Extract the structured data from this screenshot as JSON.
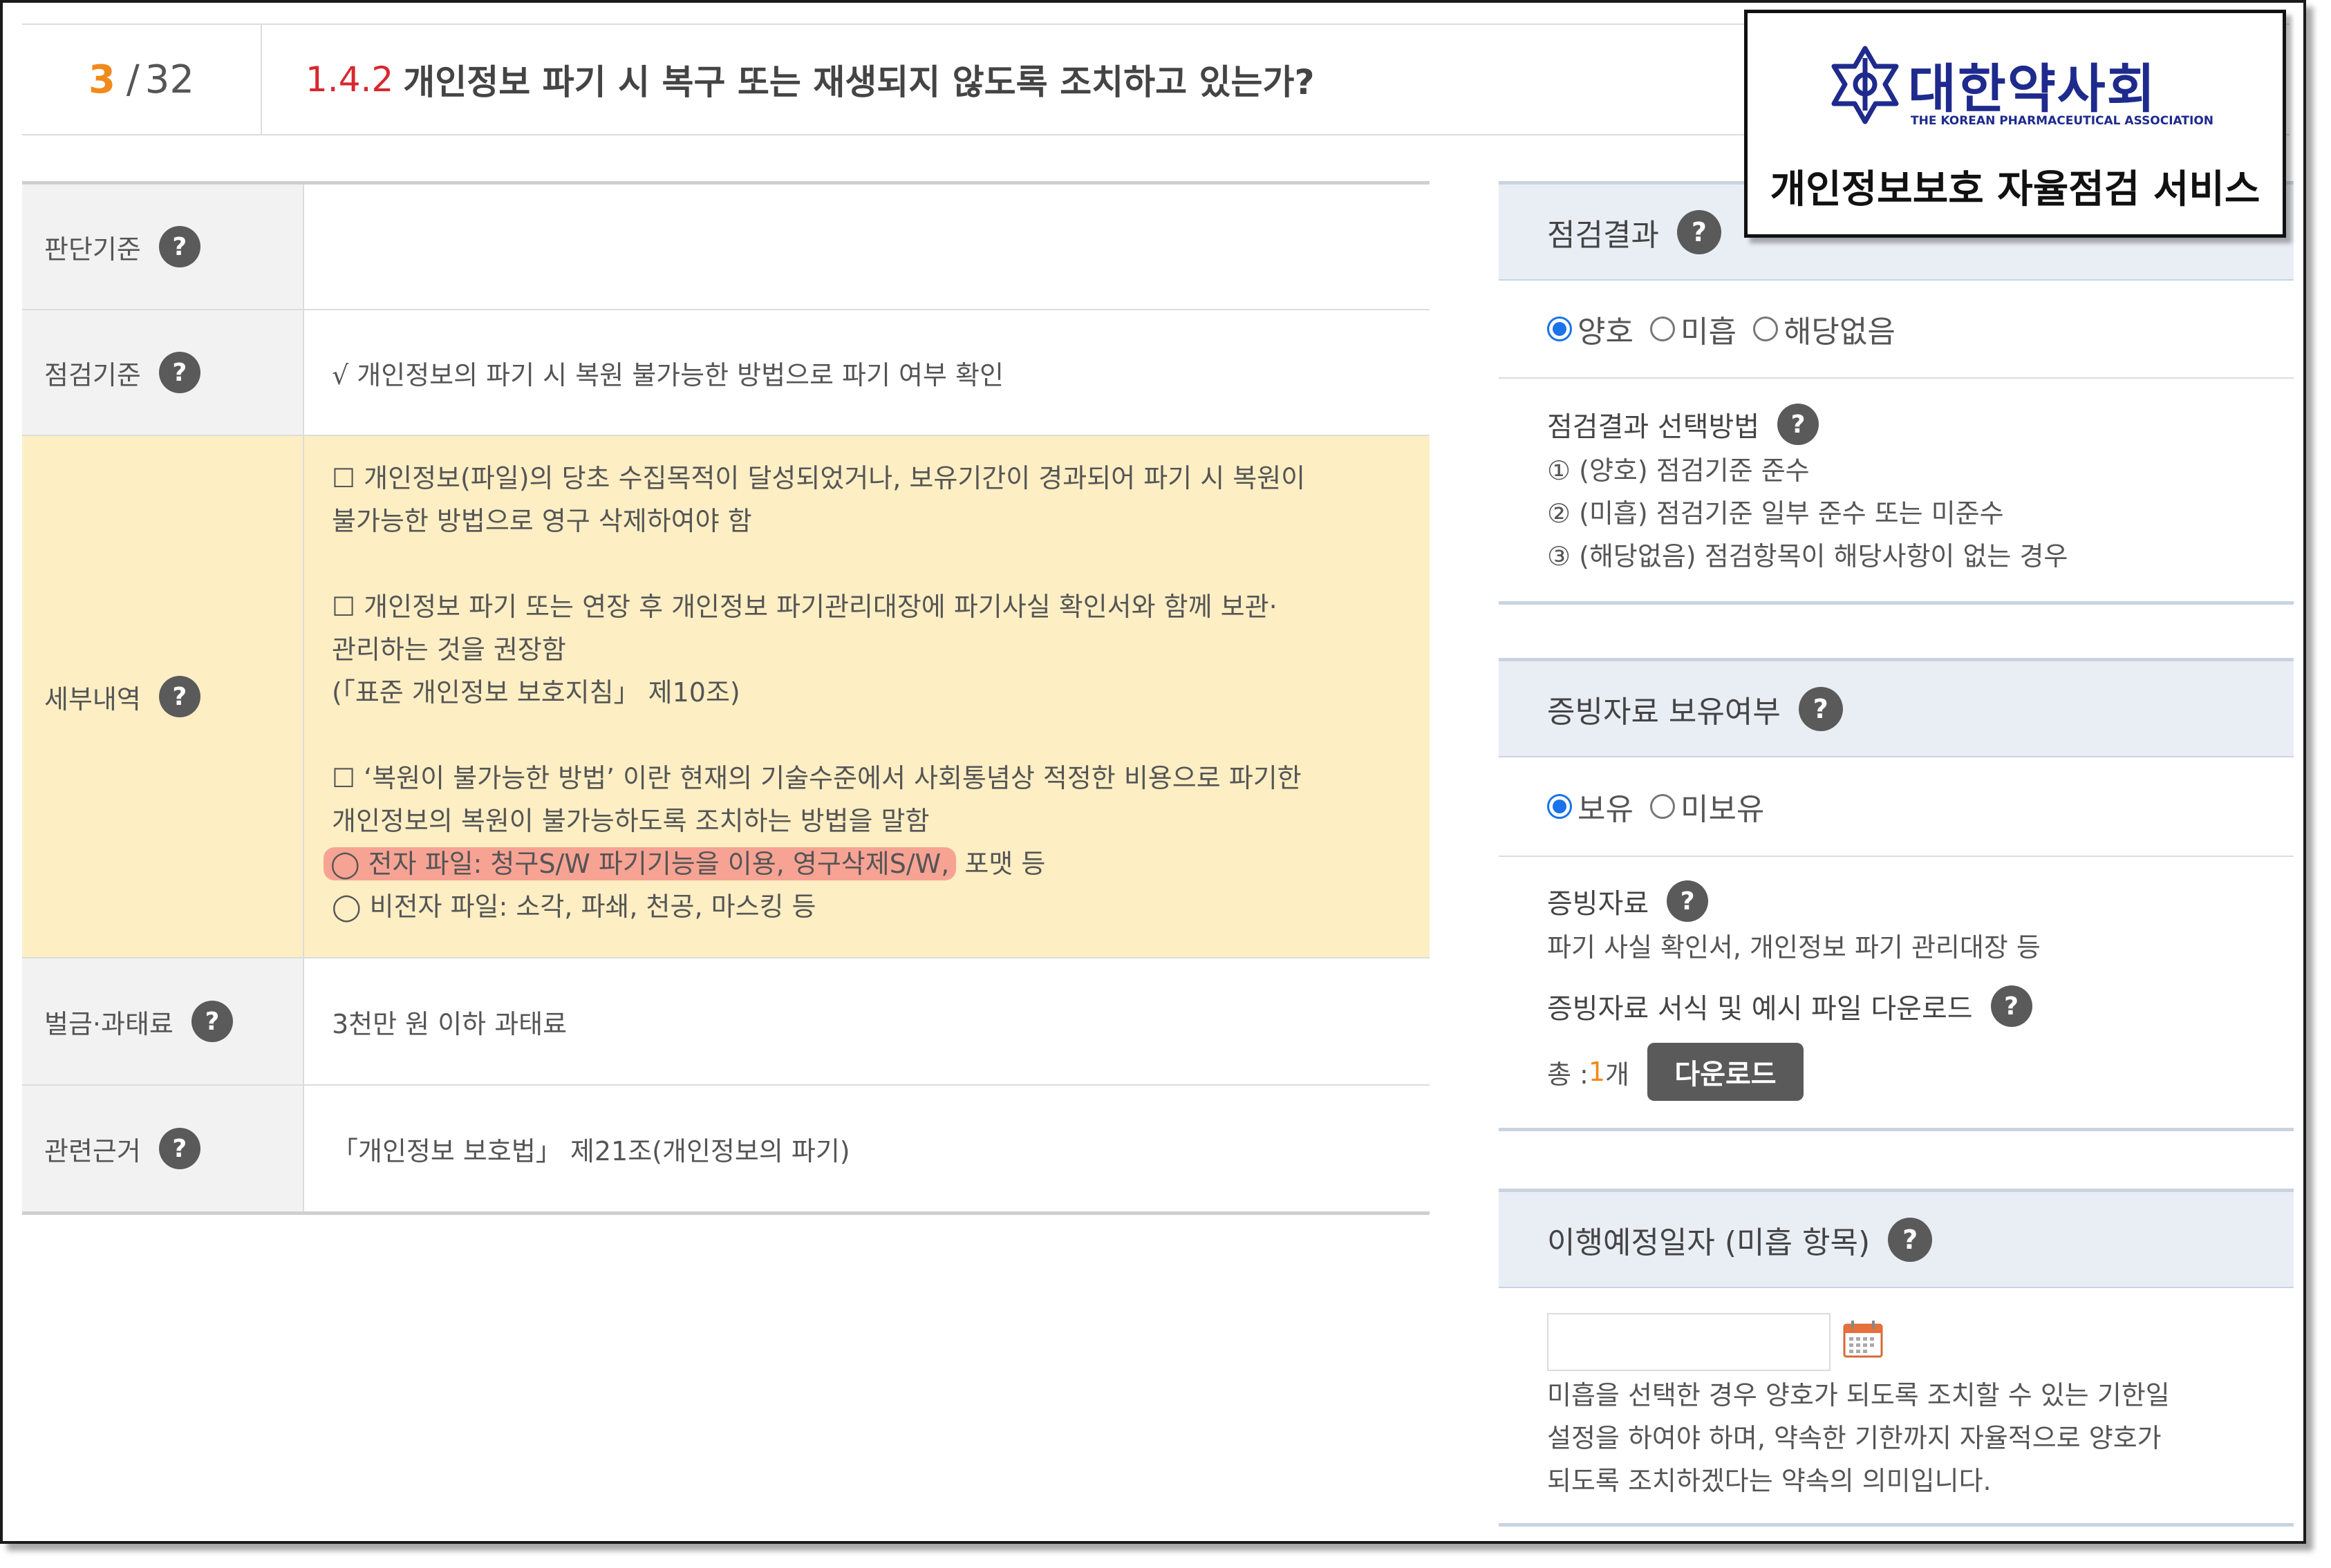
{
  "header": {
    "current": "3",
    "separator": "/",
    "total": "32",
    "item_number": "1.4.2",
    "item_title": "개인정보 파기 시 복구 또는 재생되지 않도록 조치하고 있는가?"
  },
  "table": {
    "judgement_label": "판단기준",
    "check_label": "점검기준",
    "check_value": "√ 개인정보의 파기 시 복원 불가능한 방법으로 파기 여부 확인",
    "detail_label": "세부내역",
    "detail": {
      "p1_line1": "☐ 개인정보(파일)의 당초 수집목적이 달성되었거나, 보유기간이 경과되어 파기 시 복원이",
      "p1_line2": "불가능한 방법으로 영구 삭제하여야 함",
      "p2_line1": "☐ 개인정보 파기 또는 연장 후 개인정보 파기관리대장에 파기사실 확인서와 함께 보관·",
      "p2_line2": "관리하는 것을 권장함",
      "p2_line3": "(「표준 개인정보 보호지침」 제10조)",
      "p3_line1": "☐ ‘복원이 불가능한 방법’ 이란 현재의 기술수준에서 사회통념상 적정한 비용으로 파기한",
      "p3_line2": "개인정보의 복원이 불가능하도록 조치하는 방법을 말함",
      "p3_line3_marked": "◯ 전자 파일: 청구S/W 파기기능을 이용, 영구삭제S/W,",
      "p3_line3_rest": " 포맷 등",
      "p3_line4": "◯ 비전자 파일: 소각, 파쇄, 천공, 마스킹 등"
    },
    "fine_label": "벌금·과태료",
    "fine_value": "3천만 원 이하 과태료",
    "basis_label": "관련근거",
    "basis_value": "「개인정보 보호법」 제21조(개인정보의 파기)"
  },
  "result": {
    "title": "점검결과",
    "options": [
      "양호",
      "미흡",
      "해당없음"
    ],
    "selected": "양호",
    "method_title": "점검결과 선택방법",
    "method_lines": [
      "① (양호) 점검기준 준수",
      "② (미흡) 점검기준 일부 준수 또는 미준수",
      "③ (해당없음) 점검항목이 해당사항이 없는 경우"
    ]
  },
  "evidence": {
    "title": "증빙자료 보유여부",
    "options": [
      "보유",
      "미보유"
    ],
    "selected": "보유",
    "docs_title": "증빙자료",
    "docs_value": "파기 사실 확인서, 개인정보 파기 관리대장 등",
    "download_title": "증빙자료 서식 및 예시 파일 다운로드",
    "count_prefix": "총 : ",
    "count_value": "1",
    "count_suffix": "개",
    "download_button": "다운로드"
  },
  "schedule": {
    "title": "이행예정일자 (미흡 항목)",
    "date_value": "",
    "note_lines": [
      "미흡을 선택한 경우 양호가 되도록 조치할 수 있는 기한일",
      "설정을 하여야 하며, 약속한 기한까지 자율적으로 양호가",
      "되도록 조치하겠다는 약속의 의미입니다."
    ]
  },
  "logo": {
    "korean": "대한약사회",
    "english": "THE KOREAN PHARMACEUTICAL ASSOCIATION",
    "service": "개인정보보호 자율점검 서비스"
  },
  "icons": {
    "help": "question-mark-icon",
    "calendar": "calendar-icon",
    "logo_mark": "pharmacy-association-emblem-icon"
  },
  "colors": {
    "accent_orange": "#f08a1c",
    "title_red": "#d9272e",
    "highlight_row": "#fdeec4",
    "marker": "#f7a394",
    "radio_blue": "#1a73e8",
    "logo_blue": "#1e2a8c"
  }
}
